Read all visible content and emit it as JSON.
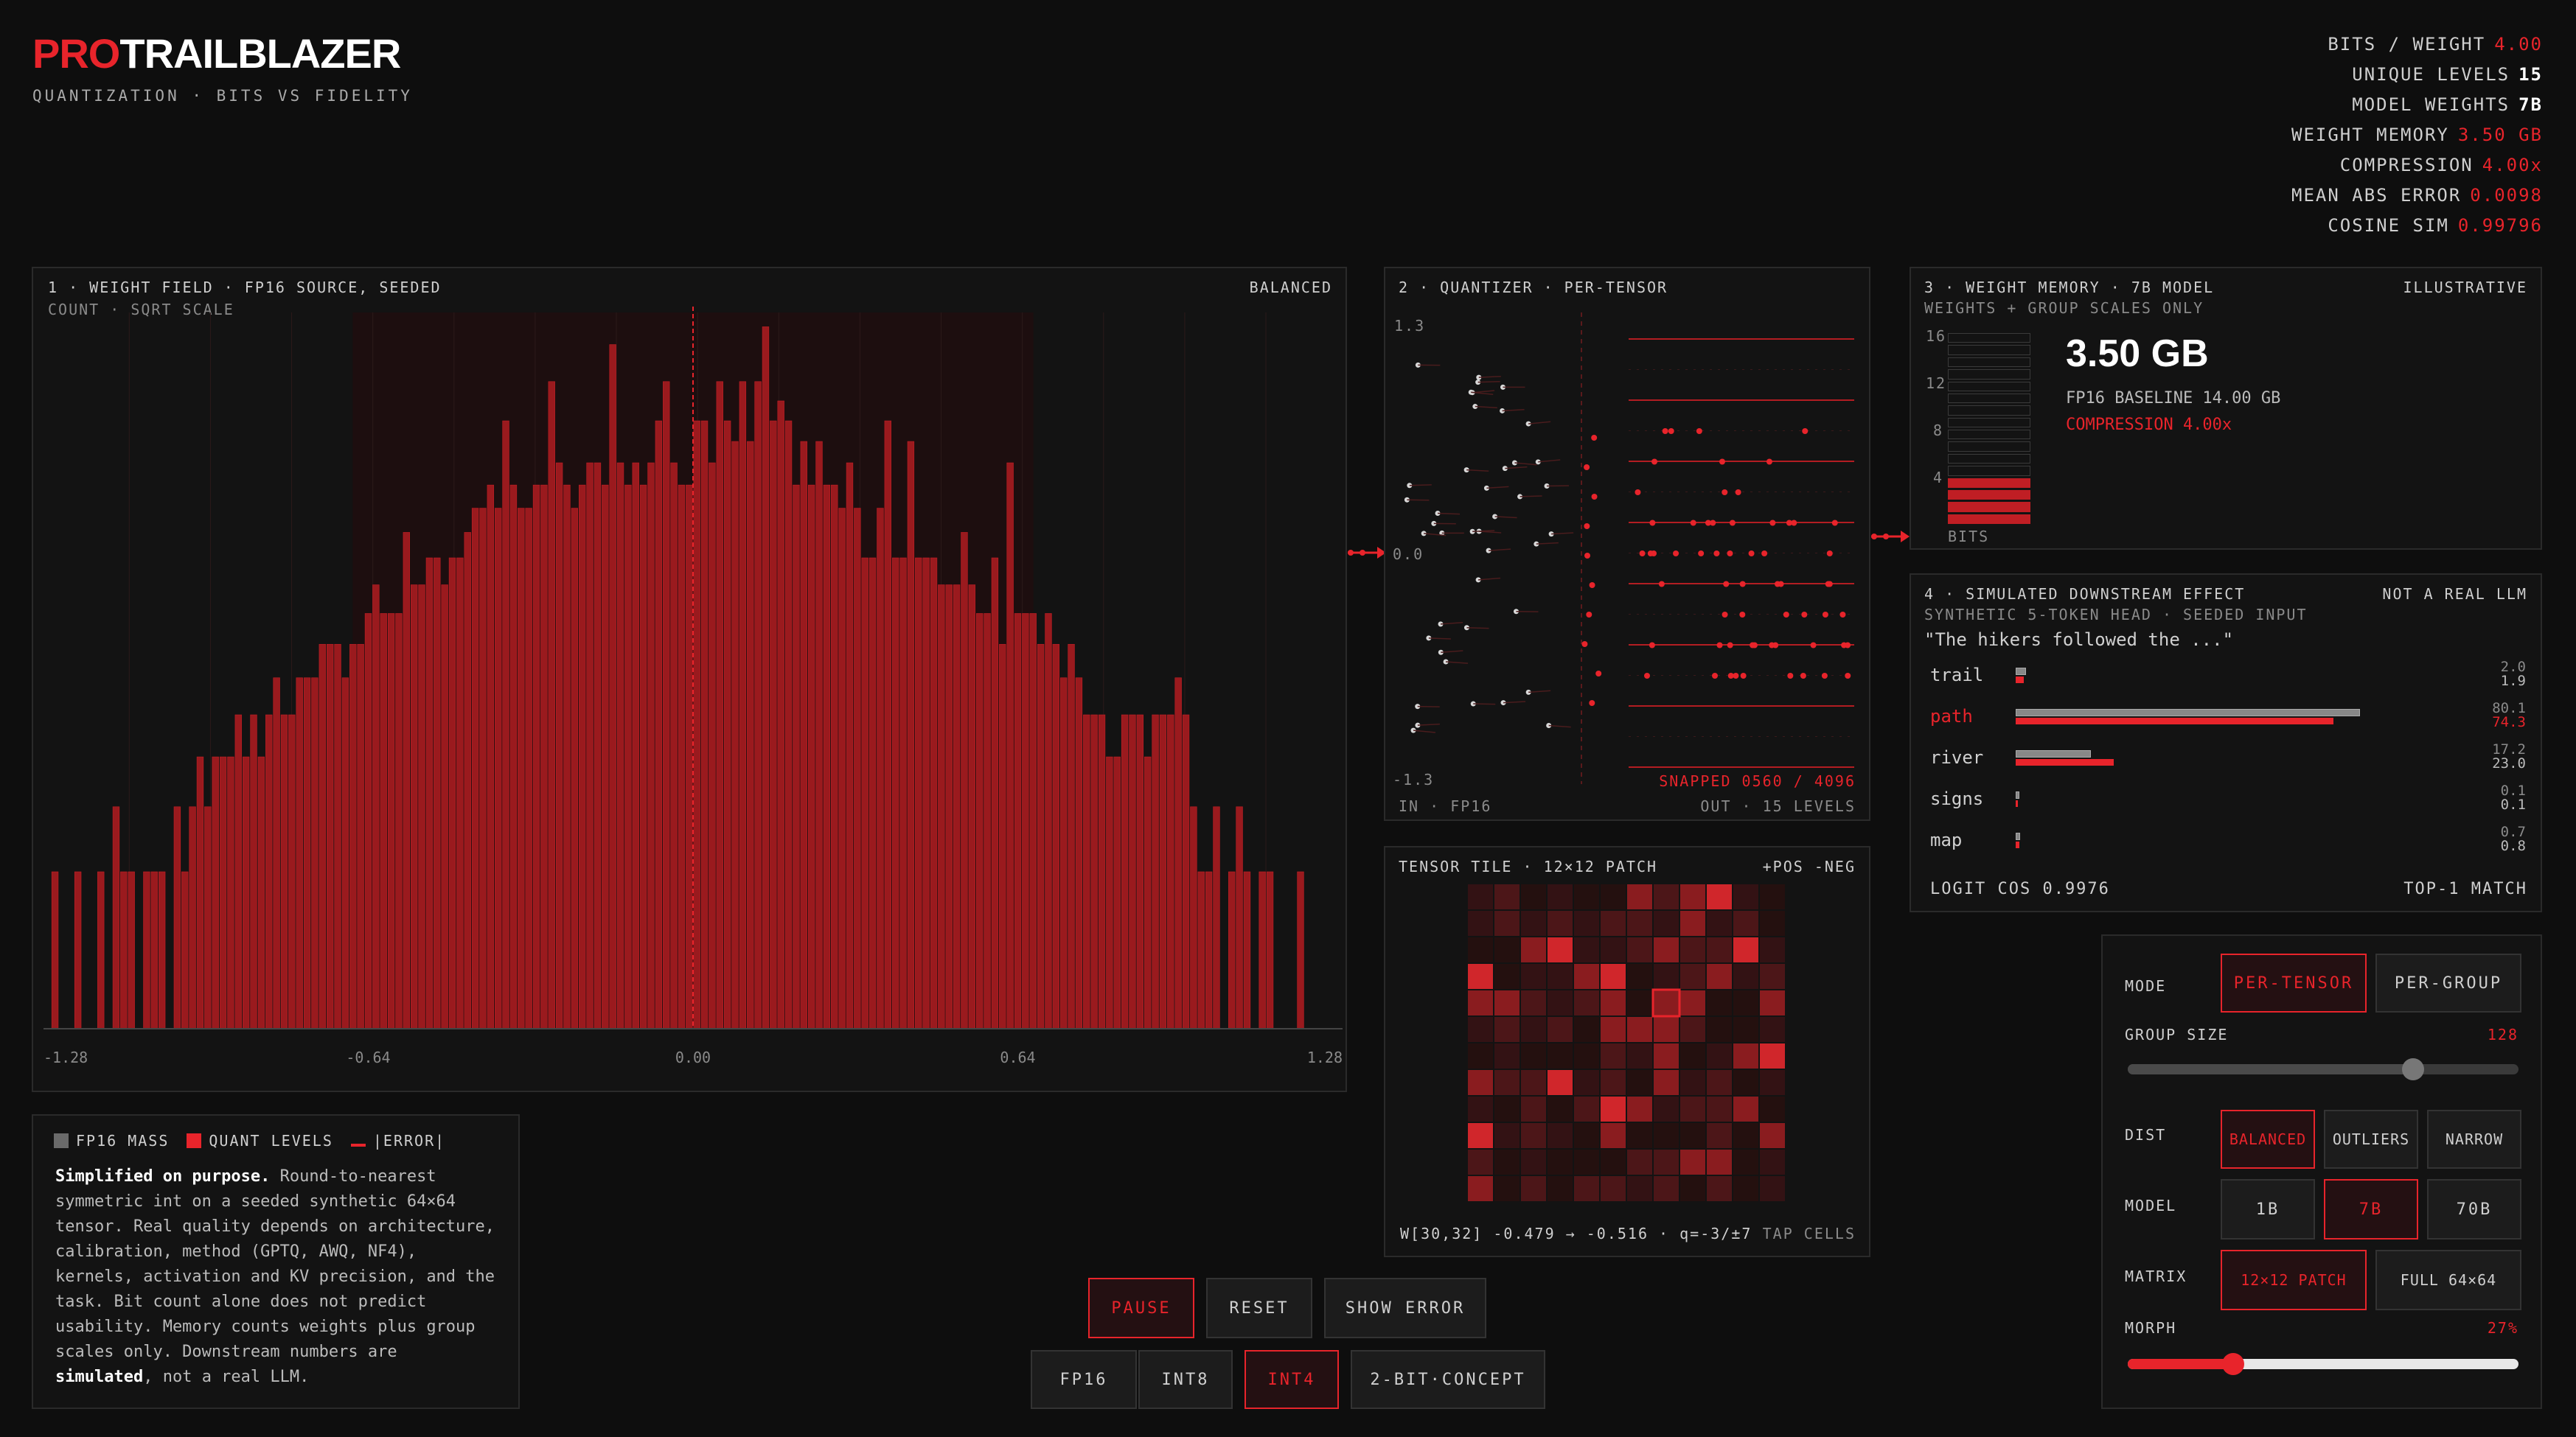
{
  "brand": {
    "prefix": "PRO",
    "name": "TRAILBLAZER",
    "subtitle": "QUANTIZATION · BITS VS FIDELITY"
  },
  "stats": [
    {
      "label": "BITS / WEIGHT",
      "value": "4.00",
      "color": "red"
    },
    {
      "label": "UNIQUE LEVELS",
      "value": "15",
      "color": "white"
    },
    {
      "label": "MODEL WEIGHTS",
      "value": "7B",
      "color": "white"
    },
    {
      "label": "WEIGHT MEMORY",
      "value": "3.50 GB",
      "color": "red"
    },
    {
      "label": "COMPRESSION",
      "value": "4.00x",
      "color": "red"
    },
    {
      "label": "MEAN ABS ERROR",
      "value": "0.0098",
      "color": "red"
    },
    {
      "label": "COSINE SIM",
      "value": "0.99796",
      "color": "red"
    }
  ],
  "panel1": {
    "title": "1 · WEIGHT FIELD · FP16 SOURCE, SEEDED",
    "tag": "BALANCED",
    "sub": "COUNT · SQRT SCALE",
    "xticks": [
      "-1.28",
      "-0.64",
      "0.00",
      "0.64",
      "1.28"
    ]
  },
  "chart_data": {
    "type": "bar",
    "x_range": [
      -1.28,
      1.28
    ],
    "values": [
      0,
      1,
      0,
      0,
      1,
      0,
      0,
      1,
      0,
      2,
      1,
      1,
      0,
      1,
      1,
      1,
      0,
      2,
      1,
      2,
      3,
      2,
      3,
      3,
      3,
      4,
      3,
      4,
      3,
      4,
      5,
      4,
      4,
      5,
      5,
      5,
      6,
      6,
      6,
      5,
      6,
      6,
      7,
      8,
      7,
      7,
      7,
      10,
      8,
      8,
      9,
      9,
      8,
      9,
      9,
      10,
      11,
      11,
      12,
      11,
      15,
      12,
      11,
      11,
      12,
      12,
      17,
      13,
      12,
      11,
      12,
      13,
      13,
      12,
      19,
      13,
      12,
      13,
      12,
      13,
      15,
      17,
      13,
      12,
      12,
      15,
      15,
      13,
      17,
      15,
      14,
      17,
      14,
      17,
      20,
      15,
      16,
      15,
      12,
      14,
      12,
      14,
      12,
      12,
      11,
      13,
      11,
      9,
      9,
      11,
      15,
      9,
      9,
      14,
      9,
      9,
      9,
      8,
      8,
      8,
      10,
      8,
      7,
      7,
      9,
      6,
      13,
      7,
      7,
      7,
      6,
      7,
      6,
      5,
      6,
      5,
      4,
      4,
      4,
      3,
      3,
      4,
      4,
      4,
      3,
      4,
      4,
      4,
      5,
      4,
      2,
      1,
      1,
      2,
      0,
      1,
      2,
      1,
      0,
      1,
      1,
      0,
      0,
      0,
      1,
      0,
      0,
      0,
      0,
      0
    ]
  },
  "legend": {
    "fp16": "FP16 MASS",
    "quant": "QUANT LEVELS",
    "error": "|ERROR|",
    "text_bold": "Simplified on purpose.",
    "text1": " Round-to-nearest symmetric int on a seeded synthetic 64×64 tensor. Real quality depends on architecture, calibration, method (GPTQ, AWQ, NF4), kernels, activation and KV precision, and the task. Bit count alone does not predict usability. Memory counts weights plus group scales only. Downstream numbers are ",
    "text_bold2": "simulated",
    "text2": ", not a real LLM."
  },
  "panel2": {
    "title": "2 · QUANTIZER · PER-TENSOR",
    "ymax": "1.3",
    "ymid": "0.0",
    "ymin": "-1.3",
    "snapped": "SNAPPED 0560 / 4096",
    "in_label": "IN · FP16",
    "out_label": "OUT · 15 LEVELS"
  },
  "panel3": {
    "title": "3 · WEIGHT MEMORY · 7B MODEL",
    "tag": "ILLUSTRATIVE",
    "sub": "WEIGHTS + GROUP SCALES ONLY",
    "big": "3.50 GB",
    "baseline": "FP16 BASELINE 14.00 GB",
    "compression": "COMPRESSION 4.00x",
    "yticks": [
      "16",
      "12",
      "8",
      "4"
    ],
    "bits_label": "BITS",
    "bits_filled": 4,
    "bits_total": 16
  },
  "panel4": {
    "title": "4 · SIMULATED DOWNSTREAM EFFECT",
    "tag": "NOT A REAL LLM",
    "sub": "SYNTHETIC 5-TOKEN HEAD · SEEDED INPUT",
    "prompt": "\"The hikers followed the ...\"",
    "tokens": [
      {
        "name": "trail",
        "fp": "2.0",
        "q": "1.9"
      },
      {
        "name": "path",
        "fp": "80.1",
        "q": "74.3"
      },
      {
        "name": "river",
        "fp": "17.2",
        "q": "23.0"
      },
      {
        "name": "signs",
        "fp": "0.1",
        "q": "0.1"
      },
      {
        "name": "map",
        "fp": "0.7",
        "q": "0.8"
      }
    ],
    "logit": "LOGIT COS 0.9976",
    "match": "TOP-1 MATCH"
  },
  "tile": {
    "title": "TENSOR TILE · 12×12 PATCH",
    "tag": "+POS -NEG",
    "readout": "W[30,32] -0.479 → -0.516 · q=-3/±7",
    "tap": "TAP CELLS"
  },
  "controls": {
    "mode_label": "MODE",
    "mode_options": [
      "PER-TENSOR",
      "PER-GROUP"
    ],
    "group_label": "GROUP SIZE",
    "group_value": "128",
    "group_fraction": 0.73,
    "dist_label": "DIST",
    "dist_options": [
      "BALANCED",
      "OUTLIERS",
      "NARROW"
    ],
    "model_label": "MODEL",
    "model_options": [
      "1B",
      "7B",
      "70B"
    ],
    "matrix_label": "MATRIX",
    "matrix_options": [
      "12×12 PATCH",
      "FULL 64×64"
    ],
    "morph_label": "MORPH",
    "morph_value": "27%",
    "morph_fraction": 0.27
  },
  "bottom": {
    "pause": "PAUSE",
    "reset": "RESET",
    "show_error": "SHOW ERROR",
    "formats": [
      "FP16",
      "INT8",
      "INT4",
      "2-BIT·CONCEPT"
    ]
  },
  "colors": {
    "accent": "#e8242b",
    "bg": "#0e0e0e",
    "panel": "#131313"
  }
}
